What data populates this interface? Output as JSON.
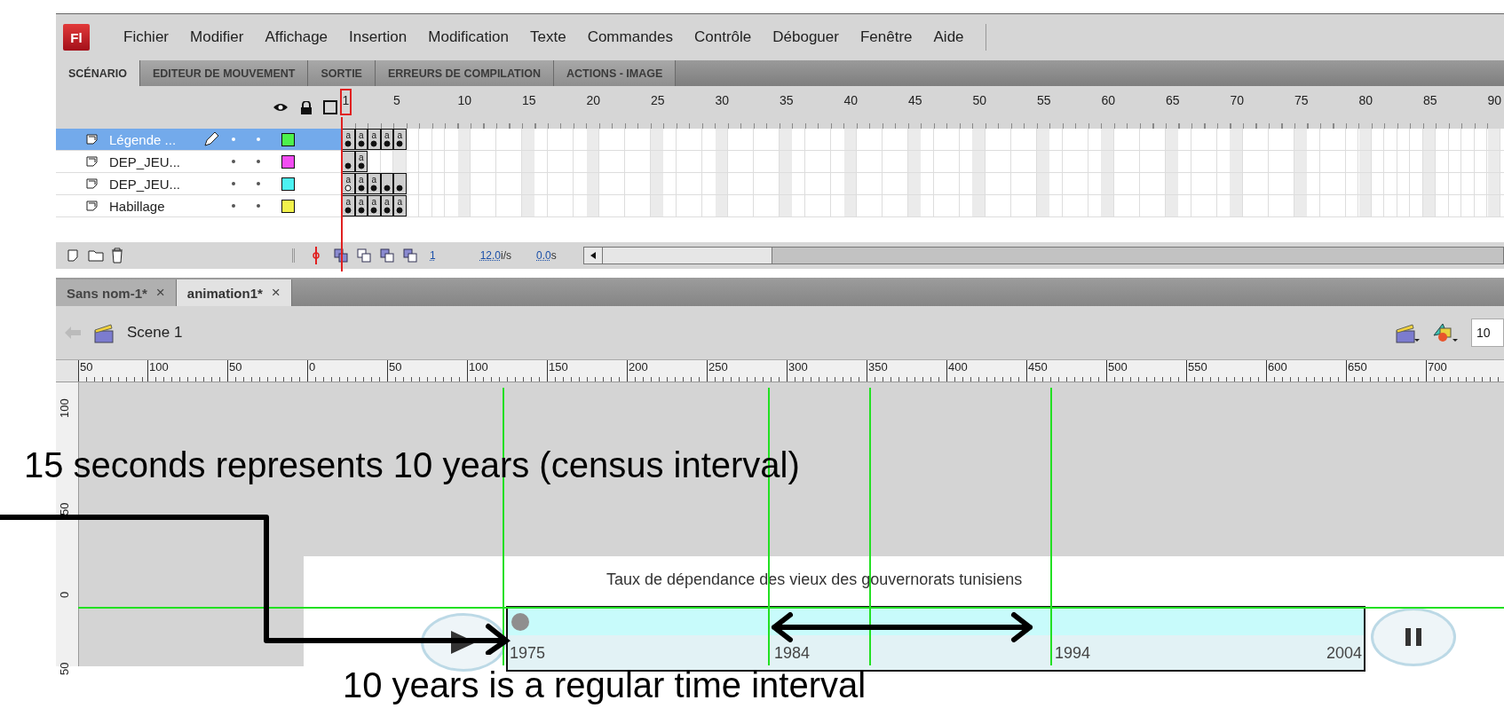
{
  "menu": {
    "logo": "Fl",
    "items": [
      "Fichier",
      "Modifier",
      "Affichage",
      "Insertion",
      "Modification",
      "Texte",
      "Commandes",
      "Contrôle",
      "Déboguer",
      "Fenêtre",
      "Aide"
    ]
  },
  "panel_tabs": [
    {
      "label": "SCÉNARIO",
      "selected": true
    },
    {
      "label": "EDITEUR DE MOUVEMENT",
      "selected": false
    },
    {
      "label": "SORTIE",
      "selected": false
    },
    {
      "label": "ERREURS DE COMPILATION",
      "selected": false
    },
    {
      "label": "ACTIONS - IMAGE",
      "selected": false
    }
  ],
  "timeline": {
    "frame_numbers": [
      "1",
      "5",
      "10",
      "15",
      "20",
      "25",
      "30",
      "35",
      "40",
      "45",
      "50",
      "55",
      "60",
      "65",
      "70",
      "75",
      "80",
      "85",
      "90"
    ],
    "layers": [
      {
        "name": "Légende ...",
        "selected": true,
        "color": "#4cf24c",
        "frames": [
          {
            "label": "a",
            "kind": "keyframe"
          },
          {
            "label": "a",
            "kind": "keyframe"
          },
          {
            "label": "a",
            "kind": "keyframe"
          },
          {
            "label": "a",
            "kind": "keyframe"
          },
          {
            "label": "a",
            "kind": "keyframe"
          }
        ]
      },
      {
        "name": "DEP_JEU...",
        "selected": false,
        "color": "#f24cf2",
        "frames": [
          {
            "kind": "keyframe"
          },
          {
            "label": "a",
            "kind": "keyframe"
          }
        ]
      },
      {
        "name": "DEP_JEU...",
        "selected": false,
        "color": "#4cf2f2",
        "frames": [
          {
            "label": "a",
            "kind": "blank"
          },
          {
            "label": "a",
            "kind": "keyframe"
          },
          {
            "label": "a",
            "kind": "keyframe"
          },
          {
            "kind": "keyframe"
          },
          {
            "kind": "keyframe"
          }
        ]
      },
      {
        "name": "Habillage",
        "selected": false,
        "color": "#f2f24c",
        "frames": [
          {
            "label": "a",
            "kind": "keyframe"
          },
          {
            "label": "a",
            "kind": "keyframe"
          },
          {
            "label": "a",
            "kind": "keyframe"
          },
          {
            "label": "a",
            "kind": "keyframe"
          },
          {
            "label": "a",
            "kind": "keyframe"
          }
        ]
      }
    ],
    "footer": {
      "current_frame": "1",
      "frame_rate": "12.0",
      "frame_rate_unit": "i/s",
      "elapsed": "0.0",
      "elapsed_unit": "s"
    }
  },
  "document_tabs": [
    {
      "label": "Sans nom-1*",
      "selected": false
    },
    {
      "label": "animation1*",
      "selected": true
    }
  ],
  "close_mark": "×",
  "scene": {
    "name": "Scene 1",
    "zoom": "10"
  },
  "ruler": {
    "horizontal": [
      "50",
      "100",
      "50",
      "0",
      "50",
      "100",
      "150",
      "200",
      "250",
      "300",
      "350",
      "400",
      "450",
      "500",
      "550",
      "600",
      "650",
      "700"
    ],
    "vertical": [
      "100",
      "50",
      "0",
      "50"
    ]
  },
  "stage": {
    "chart_title": "Taux de dépendance des vieux des gouvernorats tunisiens",
    "years": [
      "1975",
      "1984",
      "1994",
      "2004"
    ],
    "playback": {
      "level": 0
    }
  },
  "annotations": {
    "top": "15 seconds represents 10 years (census interval)",
    "bottom": "10 years is a regular time interval"
  }
}
